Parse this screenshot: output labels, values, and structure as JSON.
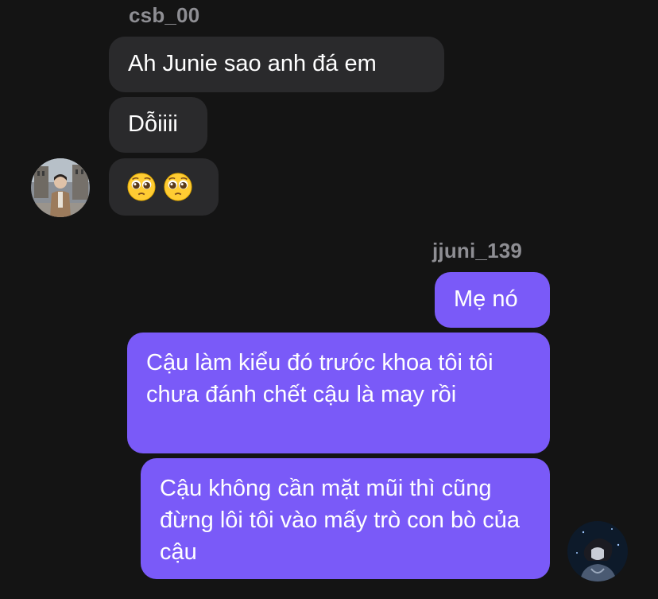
{
  "thread": {
    "incoming": {
      "sender": "csb_00",
      "messages": [
        "Ah Junie sao anh đá em",
        "Dỗiiii"
      ],
      "emoji_message": [
        "pleading-face",
        "pleading-face"
      ]
    },
    "outgoing": {
      "sender": "jjuni_139",
      "messages": [
        "Mẹ nó",
        "Cậu làm kiểu đó trước khoa tôi tôi chưa đánh chết cậu là may rồi",
        "Cậu không cần mặt mũi thì cũng đừng lôi tôi vào mấy trò con bò của cậu"
      ]
    }
  },
  "colors": {
    "background": "#141414",
    "incoming_bubble": "#2a2a2c",
    "outgoing_bubble": "#7a5af8",
    "sender_name": "#8e8e93"
  }
}
